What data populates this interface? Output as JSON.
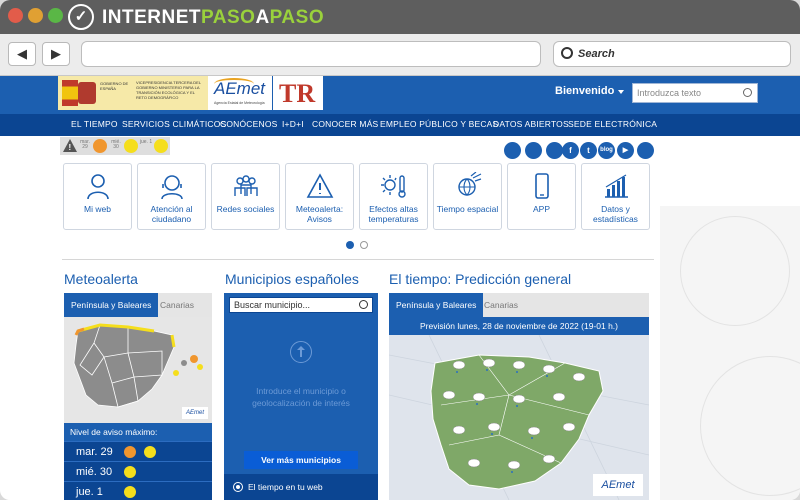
{
  "browser": {
    "brand_prefix": "INTERNET",
    "brand_middle": "PASO",
    "brand_a": "A",
    "brand_suffix": "PASO",
    "back_glyph": "◀",
    "forward_glyph": "▶",
    "search_placeholder": "Search"
  },
  "header": {
    "gov_left": "GOBIERNO DE ESPAÑA",
    "gov_right": "VICEPRESIDENCIA TERCERA DEL GOBIERNO MINISTERIO PARA LA TRANSICIÓN ECOLÓGICA Y EL RETO DEMOGRÁFICO",
    "aemet_name": "AEmet",
    "aemet_sub": "Agencia Estatal de Meteorología",
    "prtr": "TR",
    "welcome": "Bienvenido",
    "search_placeholder": "Introduzca texto"
  },
  "menu": [
    "EL TIEMPO",
    "SERVICIOS CLIMÁTICOS",
    "CONÓCENOS",
    "I+D+I",
    "CONOCER MÁS",
    "EMPLEO PÚBLICO Y BECAS",
    "DATOS ABIERTOS",
    "SEDE ELECTRÓNICA"
  ],
  "warnings": {
    "days": [
      {
        "label": "mar. 29",
        "color": "#f0962e"
      },
      {
        "label": "mié. 30",
        "color": "#f5de1c"
      },
      {
        "label": "jue. 1",
        "color": "#f5de1c"
      }
    ]
  },
  "social": [
    "app-icon",
    "rss-blue-icon",
    "group-icon",
    "facebook-icon",
    "twitter-icon",
    "blog-icon",
    "youtube-icon",
    "rss-icon"
  ],
  "social_text": [
    "",
    "",
    "",
    "f",
    "t",
    "blog",
    "▶",
    ""
  ],
  "tiles": [
    {
      "label": "Mi web",
      "icon": "person-icon"
    },
    {
      "label": "Atención al ciudadano",
      "icon": "headset-icon"
    },
    {
      "label": "Redes sociales",
      "icon": "people-icon"
    },
    {
      "label": "Meteoalerta: Avisos",
      "icon": "warning-icon"
    },
    {
      "label": "Efectos altas temperaturas",
      "icon": "sun-thermometer-icon"
    },
    {
      "label": "Tiempo espacial",
      "icon": "space-weather-icon"
    },
    {
      "label": "APP",
      "icon": "phone-icon"
    },
    {
      "label": "Datos y estadísticas",
      "icon": "bar-chart-icon"
    }
  ],
  "sections": {
    "meteoalerta": {
      "title": "Meteoalerta",
      "tab_active": "Península y Baleares",
      "tab_other": "Canarias",
      "level_label": "Nivel de aviso máximo:",
      "rows": [
        {
          "day": "mar. 29",
          "colors": [
            "#f0962e",
            "#f5de1c"
          ]
        },
        {
          "day": "mié. 30",
          "colors": [
            "#f5de1c"
          ]
        },
        {
          "day": "jue. 1",
          "colors": [
            "#f5de1c"
          ]
        }
      ]
    },
    "municipios": {
      "title": "Municipios españoles",
      "search_placeholder": "Buscar municipio...",
      "message": "Introduce el municipio o geolocalización de interés",
      "button": "Ver más municipios",
      "footer": "El tiempo en tu web"
    },
    "prediccion": {
      "title": "El tiempo: Predicción general",
      "tab_active": "Península y Baleares",
      "tab_other": "Canarias",
      "subtitle": "Previsión lunes, 28 de noviembre de 2022 (19-01 h.)",
      "logo": "AEmet"
    }
  },
  "colors": {
    "brand_blue": "#1c5fb0",
    "nav_blue": "#0b4592",
    "accent_green": "#9ad13c"
  }
}
